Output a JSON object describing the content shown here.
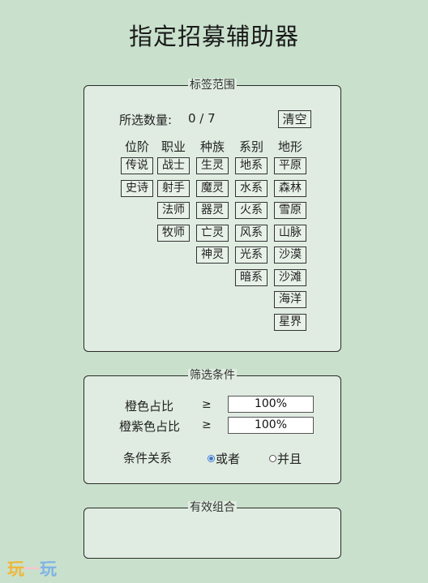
{
  "page": {
    "title": "指定招募辅助器"
  },
  "tag_panel": {
    "legend": "标签范围",
    "count_label": "所选数量:",
    "count_value": "0 / 7",
    "clear_label": "清空",
    "columns": [
      {
        "header": "位阶",
        "tags": [
          "传说",
          "史诗"
        ]
      },
      {
        "header": "职业",
        "tags": [
          "战士",
          "射手",
          "法师",
          "牧师"
        ]
      },
      {
        "header": "种族",
        "tags": [
          "生灵",
          "魔灵",
          "器灵",
          "亡灵",
          "神灵"
        ]
      },
      {
        "header": "系别",
        "tags": [
          "地系",
          "水系",
          "火系",
          "风系",
          "光系",
          "暗系"
        ]
      },
      {
        "header": "地形",
        "tags": [
          "平原",
          "森林",
          "雪原",
          "山脉",
          "沙漠",
          "沙滩",
          "海洋",
          "星界"
        ]
      }
    ]
  },
  "filter_panel": {
    "legend": "筛选条件",
    "orange_label": "橙色占比",
    "orange_ge": "≥",
    "orange_value": "100%",
    "orange_purple_label": "橙紫色占比",
    "orange_purple_ge": "≥",
    "orange_purple_value": "100%",
    "relation_label": "条件关系",
    "option_or": "或者",
    "option_and": "并且",
    "selected": "or"
  },
  "combo_panel": {
    "legend": "有效组合"
  },
  "watermark": {
    "text": "玩一玩"
  },
  "colors": {
    "background": "#c9e1cc",
    "panel": "#e0ece1",
    "radio_accent": "#3a78c8"
  }
}
